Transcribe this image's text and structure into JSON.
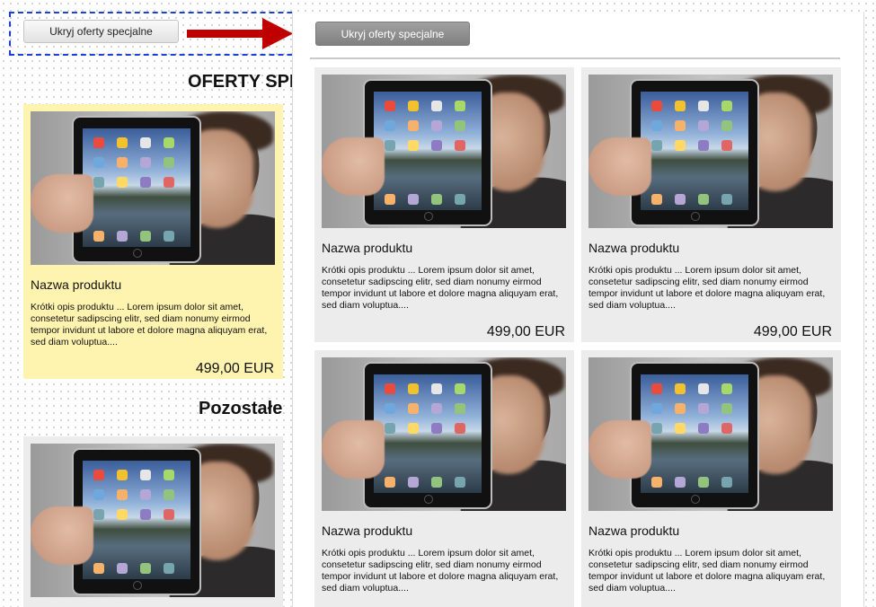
{
  "toggle_button": {
    "label": "Ukryj oferty specjalne"
  },
  "toggle_button_active": {
    "label": "Ukryj oferty specjalne"
  },
  "sections": {
    "special_offers": "OFERTY SPECJALNE",
    "others": "Pozostałe"
  },
  "product": {
    "name": "Nazwa produktu",
    "description": "Krótki opis produktu ... Lorem ipsum dolor sit amet, consetetur sadipscing elitr, sed diam nonumy eirmod tempor invidunt ut labore et dolore magna aliquyam erat, sed diam voluptua....",
    "price": "499,00 EUR"
  },
  "colors": {
    "highlight": "#fff3b0",
    "card": "#ececec",
    "arrow": "#c00000",
    "dash": "#1c3fd6"
  }
}
